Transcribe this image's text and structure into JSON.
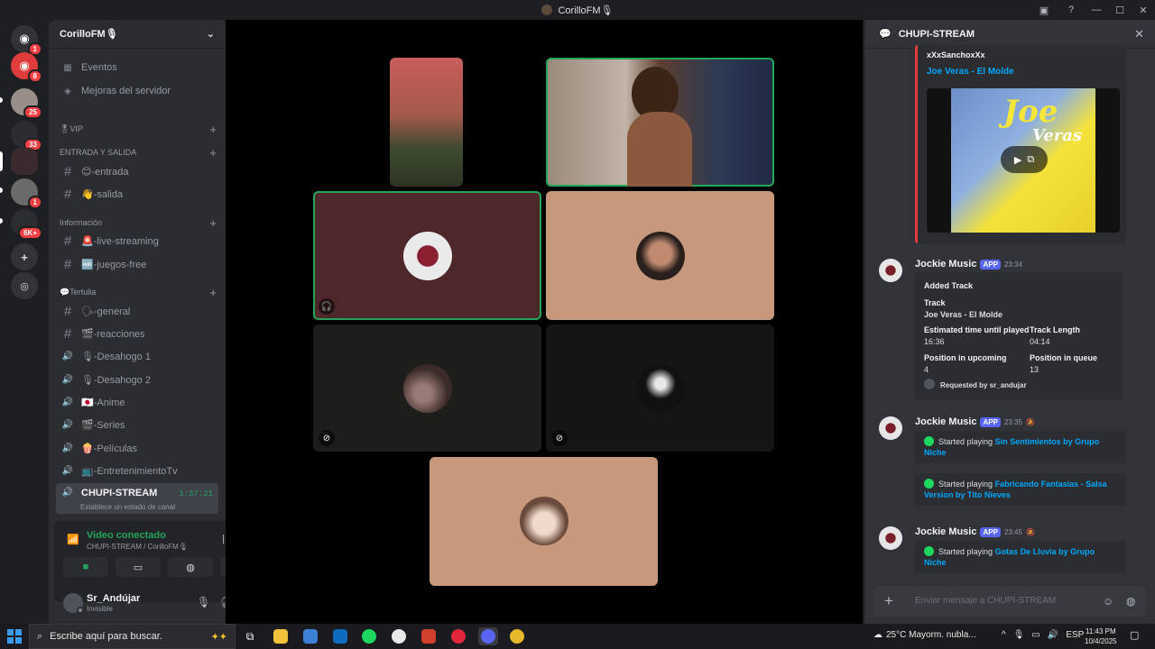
{
  "window": {
    "title": "CorilloFM🎙"
  },
  "rail": {
    "badges": [
      "1",
      "8",
      "25",
      "33",
      "1",
      "6K+"
    ]
  },
  "sidebar": {
    "guild_name": "CorilloFM🎙",
    "items": [
      {
        "label": "Eventos"
      },
      {
        "label": "Mejoras del servidor"
      }
    ],
    "categories": {
      "vip": "🎖VIP",
      "entrada": "ENTRADA Y SALIDA",
      "info": "Información",
      "tertulia": "💬Tertulia"
    },
    "channels": {
      "entrada": "😊-entrada",
      "salida": "👋-salida",
      "live": "🚨-live-streaming",
      "juegos": "🆓-juegos-free",
      "general": "🗣-general",
      "reacciones": "🎬-reacciones",
      "desahogo1": "🎙-Desahogo 1",
      "desahogo2": "🎙-Desahogo 2",
      "anime": "🇯🇵-Anime",
      "series": "🎬-Series",
      "peliculas": "🍿-Películas",
      "entretenimiento": "📺-EntretenimientoTv",
      "chupi": "CHUPI-STREAM",
      "chupi_timer": "1:37:21",
      "chupi_status": "Establece un estado de canal"
    }
  },
  "voice_panel": {
    "title": "Video conectado",
    "subtitle": "CHUPI-STREAM / CorilloFM🎙"
  },
  "user_panel": {
    "name": "Sr_Andújar",
    "status": "Invisible"
  },
  "chat": {
    "channel": "CHUPI-STREAM",
    "embed1": {
      "author": "xXxSanchoxXx",
      "title": "Joe Veras - El Molde",
      "cover_title": "Joe",
      "cover_sub": "Veras"
    },
    "messages": [
      {
        "author": "Jockie Music",
        "badge": "APP",
        "time": "23:34"
      },
      {
        "author": "Jockie Music",
        "badge": "APP",
        "time": "23:35"
      },
      {
        "author": "Jockie Music",
        "badge": "APP",
        "time": "23:45"
      }
    ],
    "added_track": {
      "heading": "Added Track",
      "track_label": "Track",
      "track_value": "Joe Veras - El Molde",
      "eta_label": "Estimated time until played",
      "eta_value": "16:36",
      "length_label": "Track Length",
      "length_value": "04:14",
      "upcoming_label": "Position in upcoming",
      "upcoming_value": "4",
      "queue_label": "Position in queue",
      "queue_value": "13",
      "requested": "Requested by sr_andujar"
    },
    "playing": [
      {
        "prefix": "Started playing",
        "track": "Sin Sentimientos by Grupo Niche"
      },
      {
        "prefix": "Started playing",
        "track": "Fabricando Fantasías - Salsa Version by Tito Nieves"
      },
      {
        "prefix": "Started playing",
        "track": "Gotas De Lluvia by Grupo Niche"
      }
    ],
    "composer_placeholder": "Enviar mensaje a CHUPI-STREAM"
  },
  "taskbar": {
    "search_placeholder": "Escribe aquí para buscar.",
    "weather": "25°C  Mayorm. nubla...",
    "lang": "ESP",
    "time": "11:43 PM",
    "date": "10/4/2025"
  },
  "colors": {
    "accent_green": "#23a55a",
    "link_blue": "#00a8fc",
    "embed_red": "#e03c3c",
    "app_badge": "#5865f2"
  }
}
